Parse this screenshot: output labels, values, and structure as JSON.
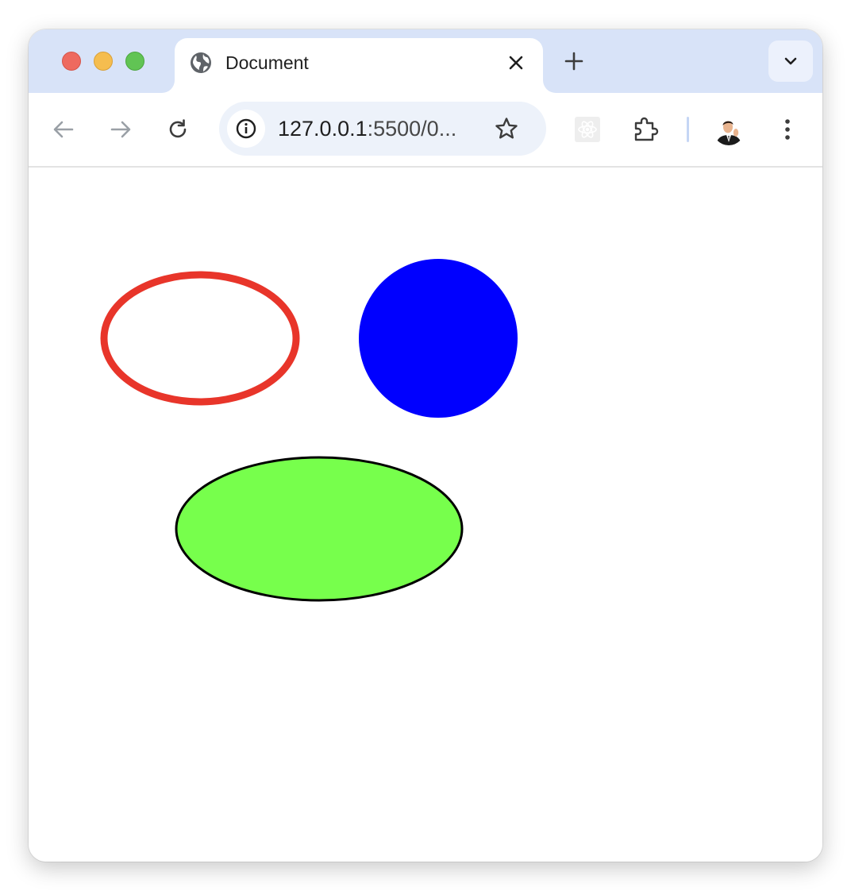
{
  "window": {
    "controls": [
      "close",
      "minimize",
      "maximize"
    ]
  },
  "tab": {
    "title": "Document",
    "favicon": "globe-icon"
  },
  "toolbar": {
    "url_host": "127.0.0.1",
    "url_rest": ":5500/0...",
    "icons": [
      "back-arrow-icon",
      "forward-arrow-icon",
      "reload-icon",
      "site-info-icon",
      "bookmark-star-icon",
      "react-devtools-icon",
      "extensions-puzzle-icon",
      "profile-avatar",
      "more-menu-icon"
    ]
  },
  "canvas": {
    "shapes": [
      {
        "name": "red-outline-ellipse",
        "fill": "#ffffff",
        "stroke": "#e8352a"
      },
      {
        "name": "blue-circle",
        "fill": "#0000ff",
        "stroke": "none"
      },
      {
        "name": "green-ellipse",
        "fill": "#77ff4c",
        "stroke": "#000000"
      }
    ]
  }
}
